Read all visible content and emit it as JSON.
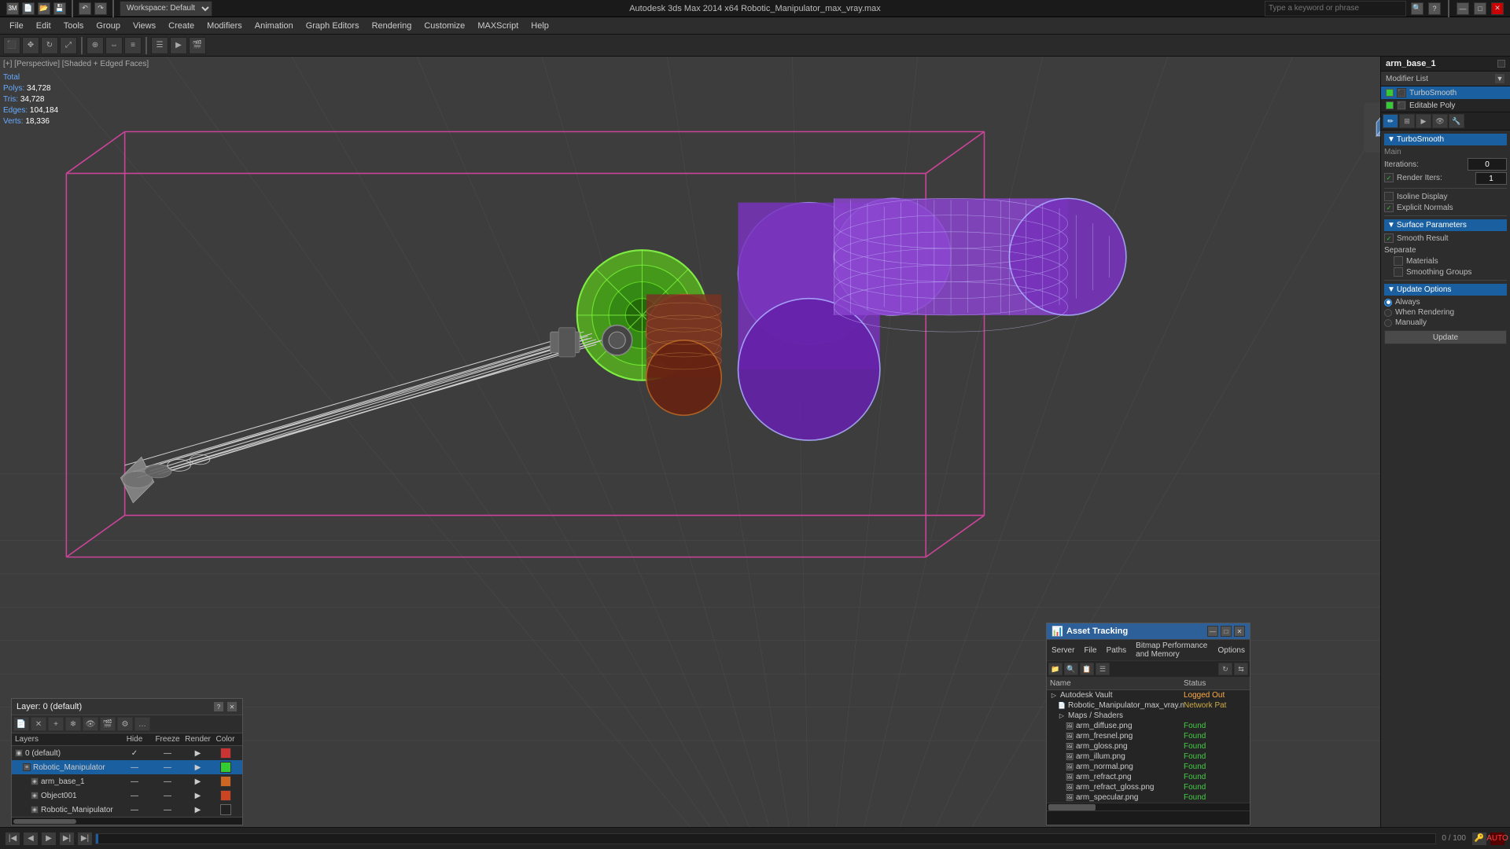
{
  "titlebar": {
    "title": "Autodesk 3ds Max 2014 x64   Robotic_Manipulator_max_vray.max",
    "minimize": "—",
    "maximize": "□",
    "close": "✕"
  },
  "toolbar": {
    "workspace_label": "Workspace: Default"
  },
  "menubar": {
    "items": [
      "File",
      "Edit",
      "Tools",
      "Group",
      "Views",
      "Create",
      "Modifiers",
      "Animation",
      "Graph Editors",
      "Rendering",
      "Customize",
      "MAXScript",
      "Help"
    ]
  },
  "viewport": {
    "label": "[+] [Perspective] [Shaded + Edged Faces]",
    "stats": {
      "total_label": "Total",
      "polys_label": "Polys:",
      "polys_val": "34,728",
      "tris_label": "Tris:",
      "tris_val": "34,728",
      "edges_label": "Edges:",
      "edges_val": "104,184",
      "verts_label": "Verts:",
      "verts_val": "18,336"
    }
  },
  "right_panel": {
    "object_name": "arm_base_1",
    "modifier_list_label": "Modifier List",
    "modifiers": [
      {
        "name": "TurboSmooth",
        "checked": true
      },
      {
        "name": "Editable Poly",
        "checked": true
      }
    ],
    "turbosmooth": {
      "section_title": "TurboSmooth",
      "main_label": "Main",
      "iterations_label": "Iterations:",
      "iterations_val": "0",
      "render_iters_label": "Render Iters:",
      "render_iters_val": "1",
      "render_iters_checked": true,
      "isoline_display_label": "Isoline Display",
      "isoline_checked": false,
      "explicit_normals_label": "Explicit Normals",
      "explicit_checked": true,
      "surface_params_label": "Surface Parameters",
      "smooth_result_label": "Smooth Result",
      "smooth_result_checked": true,
      "separate_label": "Separate",
      "materials_label": "Materials",
      "materials_checked": false,
      "smoothing_groups_label": "Smoothing Groups",
      "smoothing_checked": false,
      "update_options_label": "Update Options",
      "always_label": "Always",
      "always_selected": true,
      "when_rendering_label": "When Rendering",
      "when_rendering_selected": false,
      "manually_label": "Manually",
      "manually_selected": false,
      "update_btn": "Update"
    }
  },
  "layers_panel": {
    "title": "Layer: 0 (default)",
    "columns": {
      "name": "Layers",
      "hide": "Hide",
      "freeze": "Freeze",
      "render": "Render",
      "color": "Color"
    },
    "layers": [
      {
        "name": "0 (default)",
        "indent": 0,
        "hide": "✓",
        "freeze": "—",
        "render": "▶",
        "color": "#cc3333",
        "selected": false
      },
      {
        "name": "Robotic_Manipulator",
        "indent": 1,
        "hide": "—",
        "freeze": "—",
        "render": "▶",
        "color": "#33cc33",
        "selected": true
      },
      {
        "name": "arm_base_1",
        "indent": 2,
        "hide": "—",
        "freeze": "—",
        "render": "▶",
        "color": "#cc6622",
        "selected": false
      },
      {
        "name": "Object001",
        "indent": 2,
        "hide": "—",
        "freeze": "—",
        "render": "▶",
        "color": "#cc4422",
        "selected": false
      },
      {
        "name": "Robotic_Manipulator",
        "indent": 2,
        "hide": "—",
        "freeze": "—",
        "render": "▶",
        "color": "#222222",
        "selected": false
      }
    ]
  },
  "asset_panel": {
    "title": "Asset Tracking",
    "menus": [
      "Server",
      "File",
      "Paths",
      "Bitmap Performance and Memory",
      "Options"
    ],
    "columns": {
      "name": "Name",
      "status": "Status"
    },
    "assets": [
      {
        "name": "Autodesk Vault",
        "indent": 0,
        "status": "Logged Out",
        "icon": "🗂"
      },
      {
        "name": "Robotic_Manipulator_max_vray.max",
        "indent": 1,
        "status": "Network Pat",
        "icon": "📄"
      },
      {
        "name": "Maps / Shaders",
        "indent": 1,
        "status": "",
        "icon": "📁"
      },
      {
        "name": "arm_diffuse.png",
        "indent": 2,
        "status": "Found",
        "icon": "🖼"
      },
      {
        "name": "arm_fresnel.png",
        "indent": 2,
        "status": "Found",
        "icon": "🖼"
      },
      {
        "name": "arm_gloss.png",
        "indent": 2,
        "status": "Found",
        "icon": "🖼"
      },
      {
        "name": "arm_illum.png",
        "indent": 2,
        "status": "Found",
        "icon": "🖼"
      },
      {
        "name": "arm_normal.png",
        "indent": 2,
        "status": "Found",
        "icon": "🖼"
      },
      {
        "name": "arm_refract.png",
        "indent": 2,
        "status": "Found",
        "icon": "🖼"
      },
      {
        "name": "arm_refract_gloss.png",
        "indent": 2,
        "status": "Found",
        "icon": "🖼"
      },
      {
        "name": "arm_specular.png",
        "indent": 2,
        "status": "Found",
        "icon": "🖼"
      }
    ]
  }
}
